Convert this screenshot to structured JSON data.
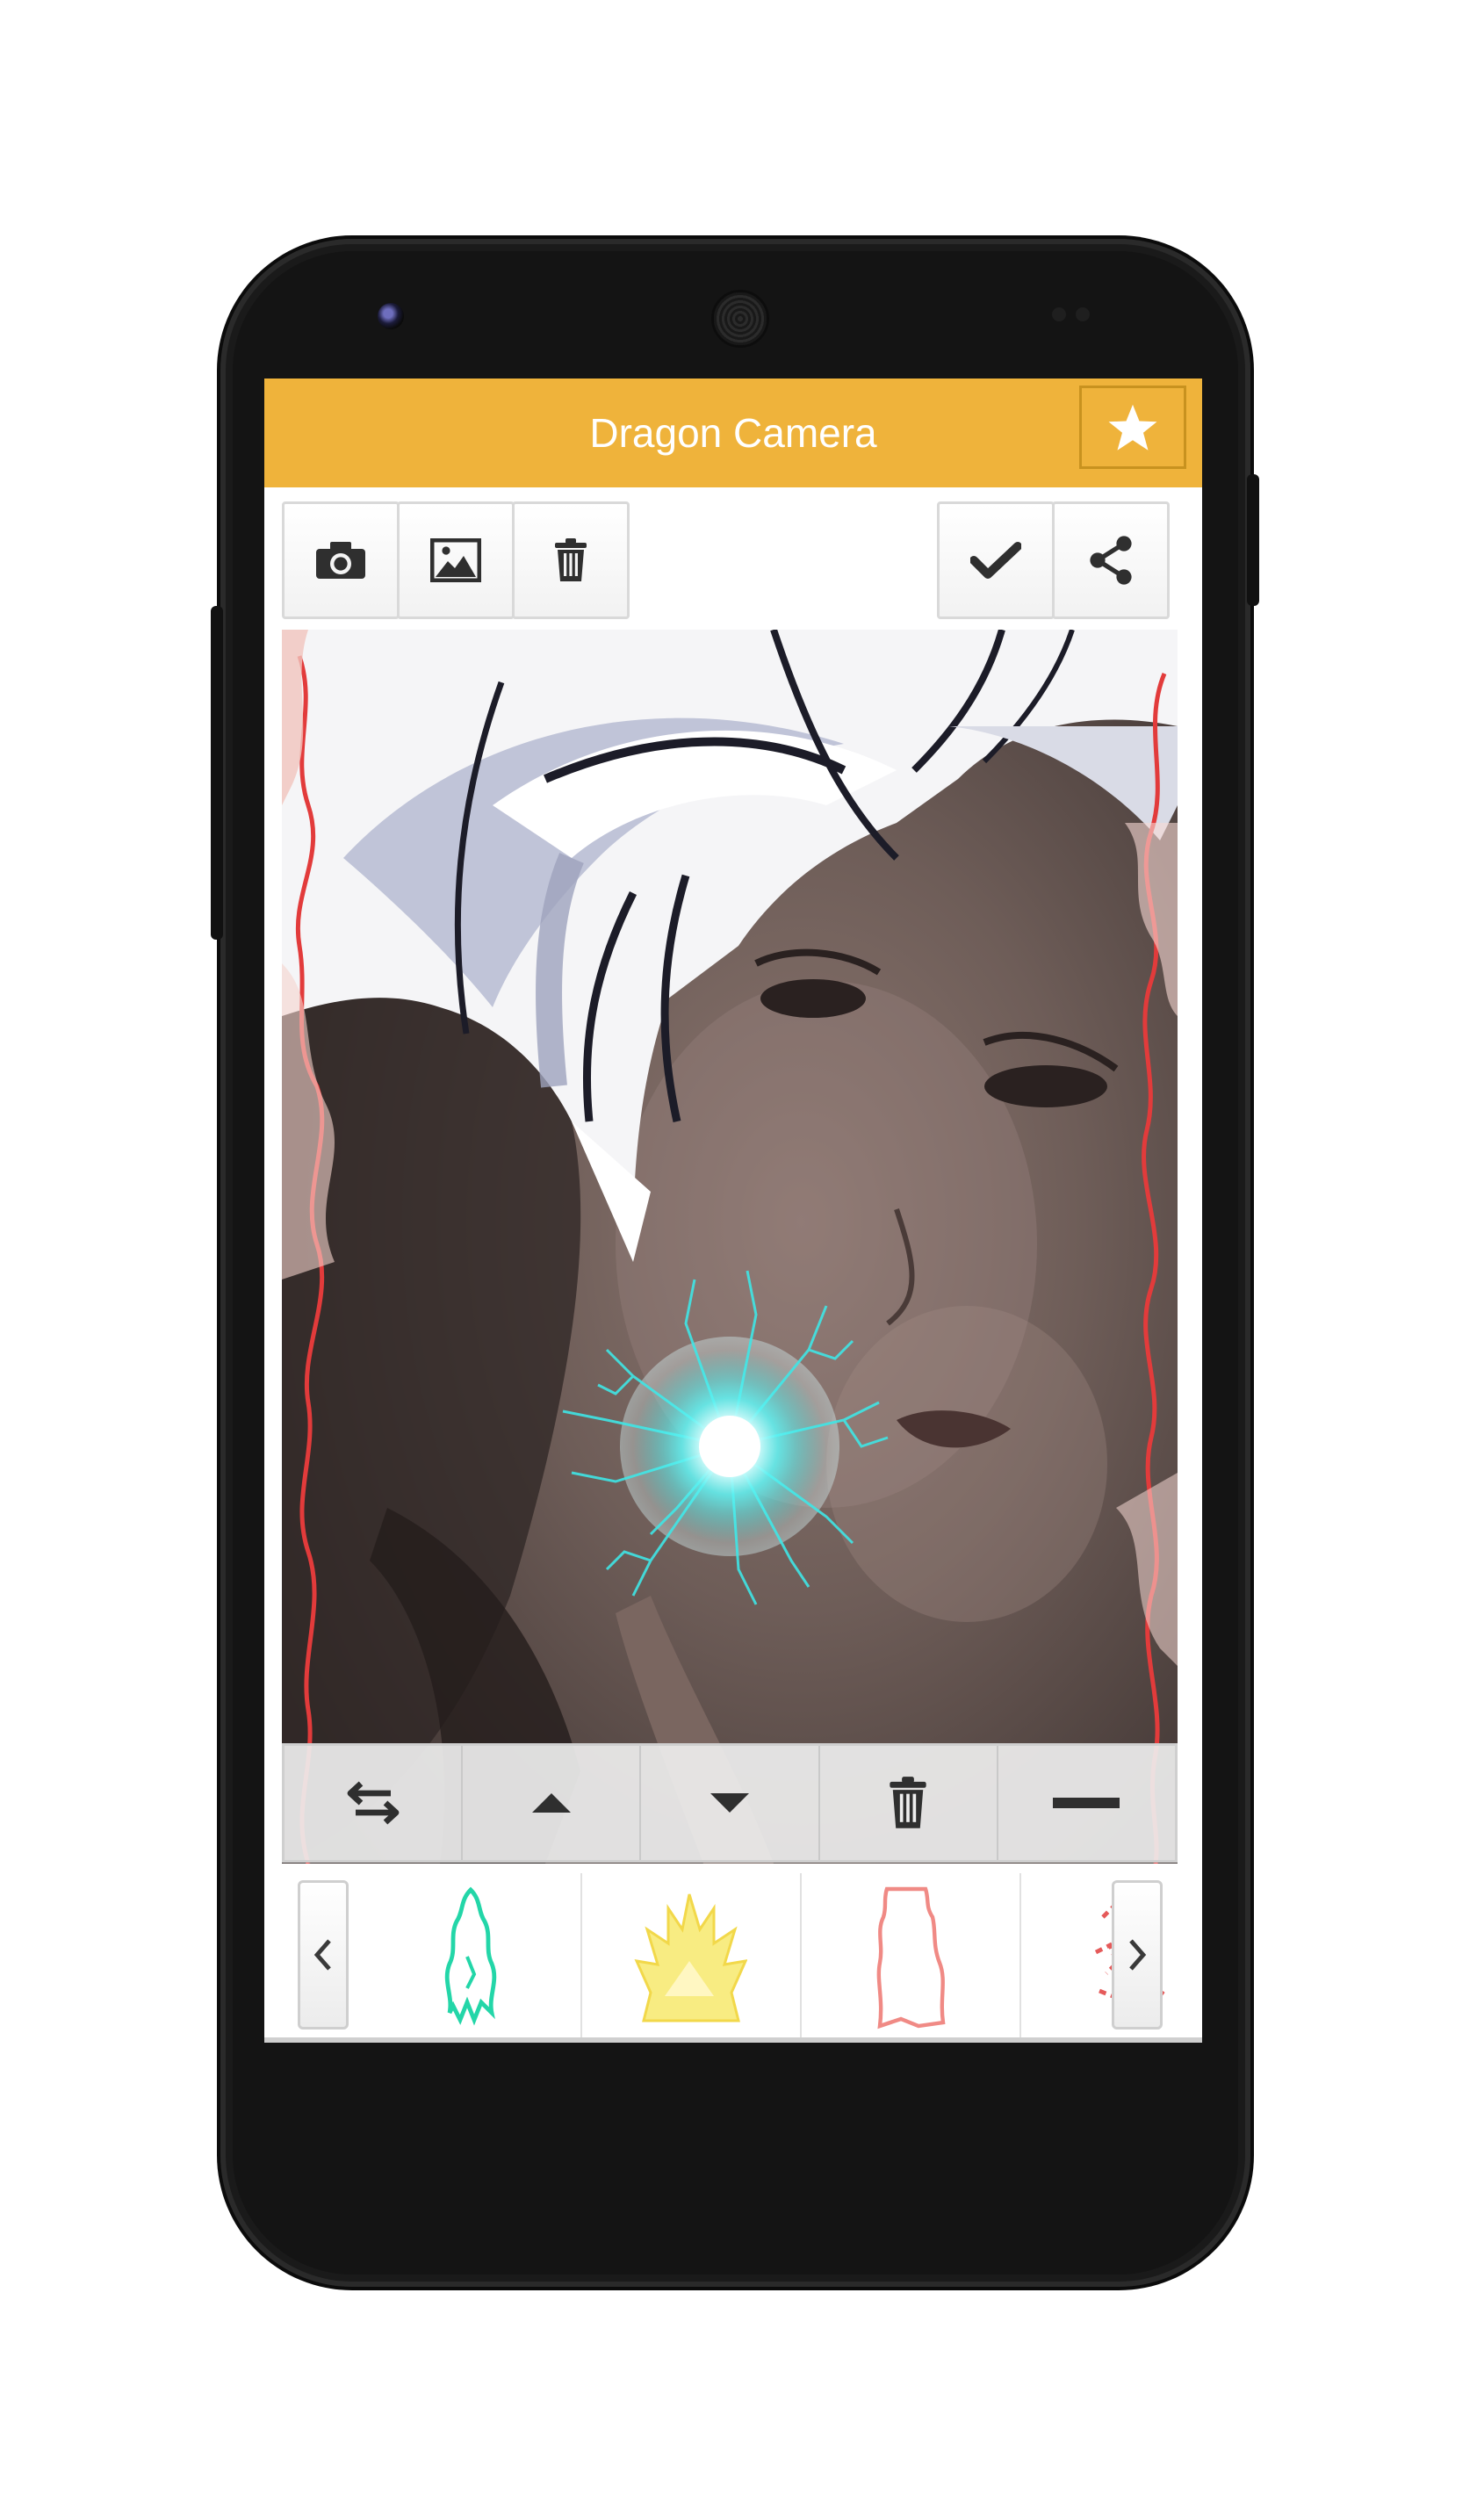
{
  "app": {
    "title": "Dragon Camera"
  },
  "header": {
    "favorite_icon": "star-icon"
  },
  "toolbar": {
    "left_buttons": [
      {
        "name": "camera-button",
        "icon": "camera-icon"
      },
      {
        "name": "gallery-button",
        "icon": "image-icon"
      },
      {
        "name": "delete-button",
        "icon": "trash-icon"
      }
    ],
    "right_buttons": [
      {
        "name": "confirm-button",
        "icon": "check-icon"
      },
      {
        "name": "share-button",
        "icon": "share-icon"
      }
    ]
  },
  "editor": {
    "controls": [
      {
        "name": "flip-button",
        "icon": "swap-arrows-icon"
      },
      {
        "name": "move-up-button",
        "icon": "triangle-up-icon"
      },
      {
        "name": "move-down-button",
        "icon": "triangle-down-icon"
      },
      {
        "name": "remove-sticker-button",
        "icon": "trash-icon"
      },
      {
        "name": "minimize-button",
        "icon": "minus-icon"
      }
    ]
  },
  "sticker_strip": {
    "prev_icon": "chevron-left-icon",
    "next_icon": "chevron-right-icon",
    "items": [
      {
        "name": "aura-cyan",
        "color": "#23d6a8"
      },
      {
        "name": "hair-yellow",
        "color": "#f7e25a"
      },
      {
        "name": "aura-red-outline",
        "color": "#f08a85"
      },
      {
        "name": "aura-red-sparks",
        "color": "#e55a5a"
      }
    ]
  },
  "colors": {
    "accent": "#efb33b",
    "energy_ball": "#3ff0f0",
    "aura_outline": "#e23b3b"
  }
}
